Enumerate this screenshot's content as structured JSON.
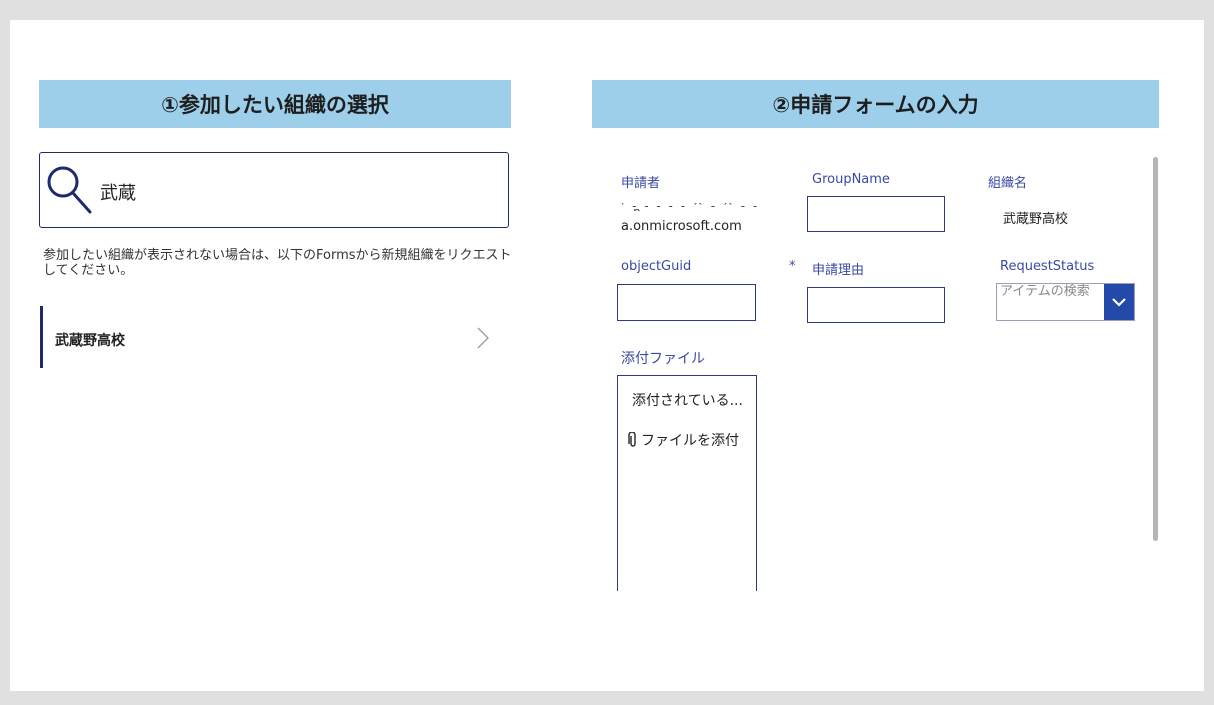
{
  "panels": {
    "left_title": "①参加したい組織の選択",
    "right_title": "②申請フォームの入力"
  },
  "search": {
    "value": "武蔵",
    "icon": "search-icon"
  },
  "hint_text": "参加したい組織が表示されない場合は、以下のFormsから新規組織をリクエストしてください。",
  "gallery": {
    "items": [
      {
        "label": "武蔵野高校"
      }
    ]
  },
  "form": {
    "applicant": {
      "label": "申請者",
      "value_partial": "' - - - - - ^ - ^ - - - n",
      "value": "a.onmicrosoft.com"
    },
    "group_name": {
      "label": "GroupName",
      "value": ""
    },
    "org_name": {
      "label": "組織名",
      "value": "武蔵野高校"
    },
    "object_guid": {
      "label": "objectGuid",
      "value": ""
    },
    "reason": {
      "required_mark": "*",
      "label": "申請理由",
      "value": ""
    },
    "request_status": {
      "label": "RequestStatus",
      "placeholder": "アイテムの検索"
    },
    "attachments": {
      "label": "添付ファイル",
      "empty_text": "添付されている...",
      "add_text": "ファイルを添付"
    }
  },
  "colors": {
    "header_bg": "#9dcfeb",
    "accent": "#1f2a6d",
    "label": "#3a49a0",
    "dropdown_btn": "#2549a8"
  }
}
